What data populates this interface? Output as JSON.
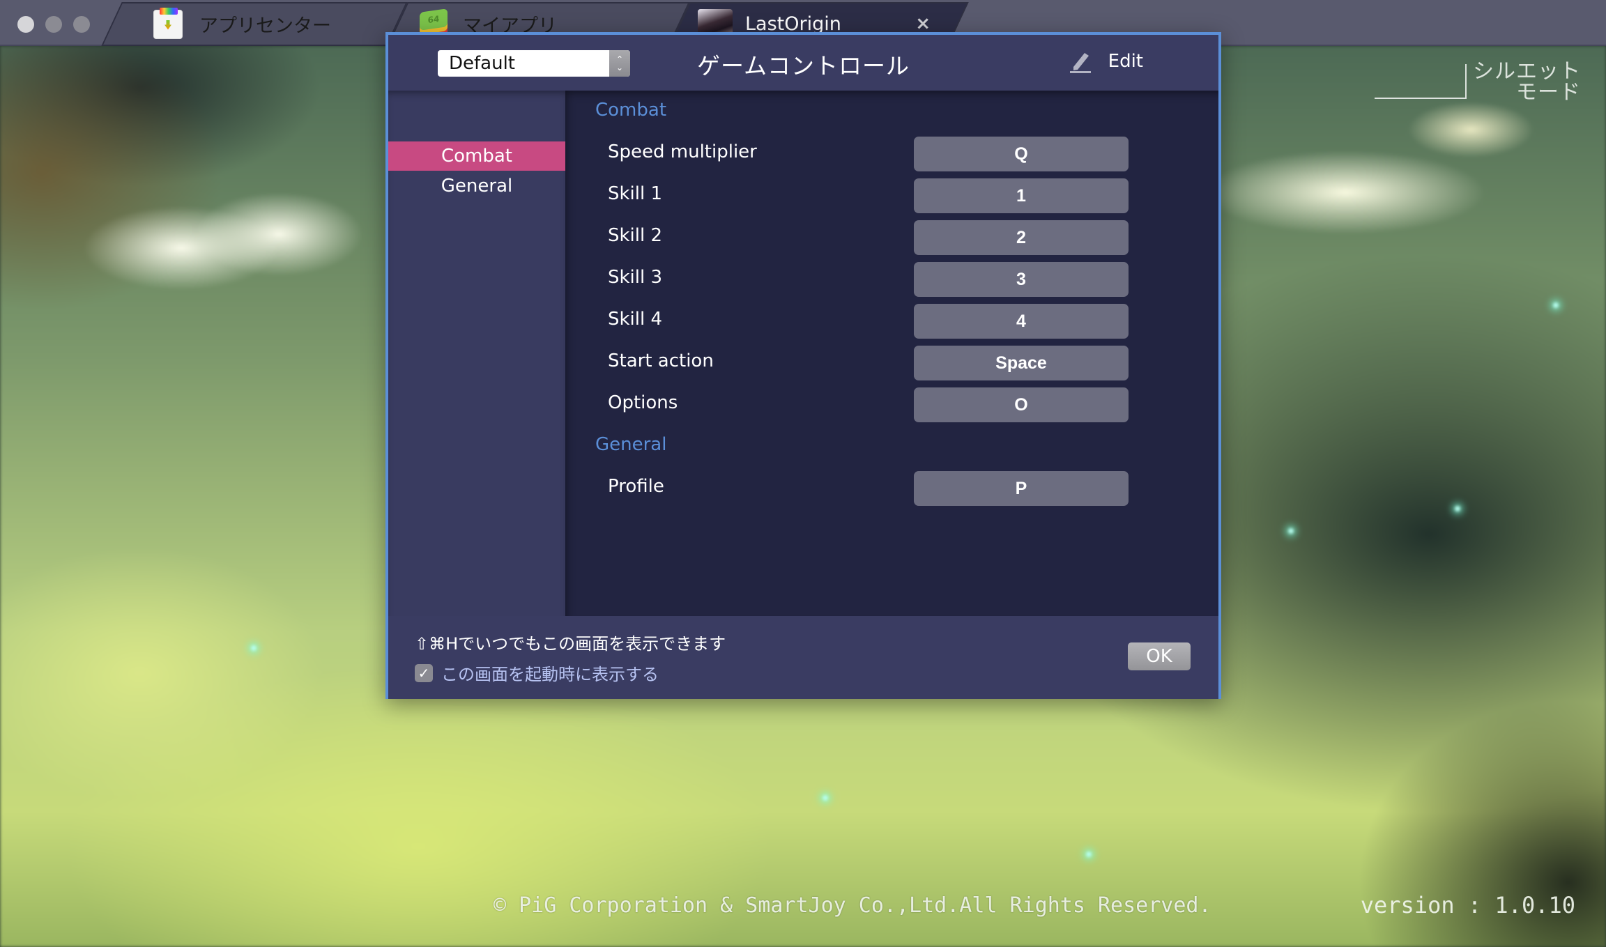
{
  "tabbar": {
    "tabs": [
      {
        "label": "アプリセンター",
        "icon": "app-center-icon",
        "active": false
      },
      {
        "label": "マイアプリ",
        "icon": "my-apps-icon",
        "active": false,
        "icon_text": "64"
      },
      {
        "label": "LastOrigin",
        "icon": "game-avatar-icon",
        "active": true,
        "close_glyph": "×"
      }
    ]
  },
  "dialog": {
    "title": "ゲームコントロール",
    "profile_select": {
      "value": "Default",
      "up_glyph": "⌃",
      "down_glyph": "⌄"
    },
    "edit_label": "Edit",
    "sidebar": {
      "items": [
        {
          "label": "Combat",
          "active": true
        },
        {
          "label": "General",
          "active": false
        }
      ]
    },
    "sections": [
      {
        "title": "Combat",
        "rows": [
          {
            "label": "Speed multiplier",
            "key": "Q"
          },
          {
            "label": "Skill 1",
            "key": "1"
          },
          {
            "label": "Skill 2",
            "key": "2"
          },
          {
            "label": "Skill 3",
            "key": "3"
          },
          {
            "label": "Skill 4",
            "key": "4"
          },
          {
            "label": "Start action",
            "key": "Space"
          },
          {
            "label": "Options",
            "key": "O"
          }
        ]
      },
      {
        "title": "General",
        "rows": [
          {
            "label": "Profile",
            "key": "P"
          }
        ]
      }
    ],
    "footer": {
      "hint": "⇧⌘Hでいつでもこの画面を表示できます",
      "show_on_startup_label": "この画面を起動時に表示する",
      "show_on_startup_checked": true,
      "check_glyph": "✓",
      "ok_label": "OK"
    }
  },
  "game": {
    "silhouette_mode": [
      "シルエット",
      "モード"
    ],
    "copyright": "© PiG Corporation & SmartJoy Co.,Ltd.All Rights Reserved.",
    "version": "version : 1.0.10"
  },
  "colors": {
    "accent_blue": "#5b8fd8",
    "active_pink": "#c84a82",
    "dialog_bg": "#3a3c62",
    "content_bg": "#222441",
    "key_button": "#6c6d80"
  }
}
